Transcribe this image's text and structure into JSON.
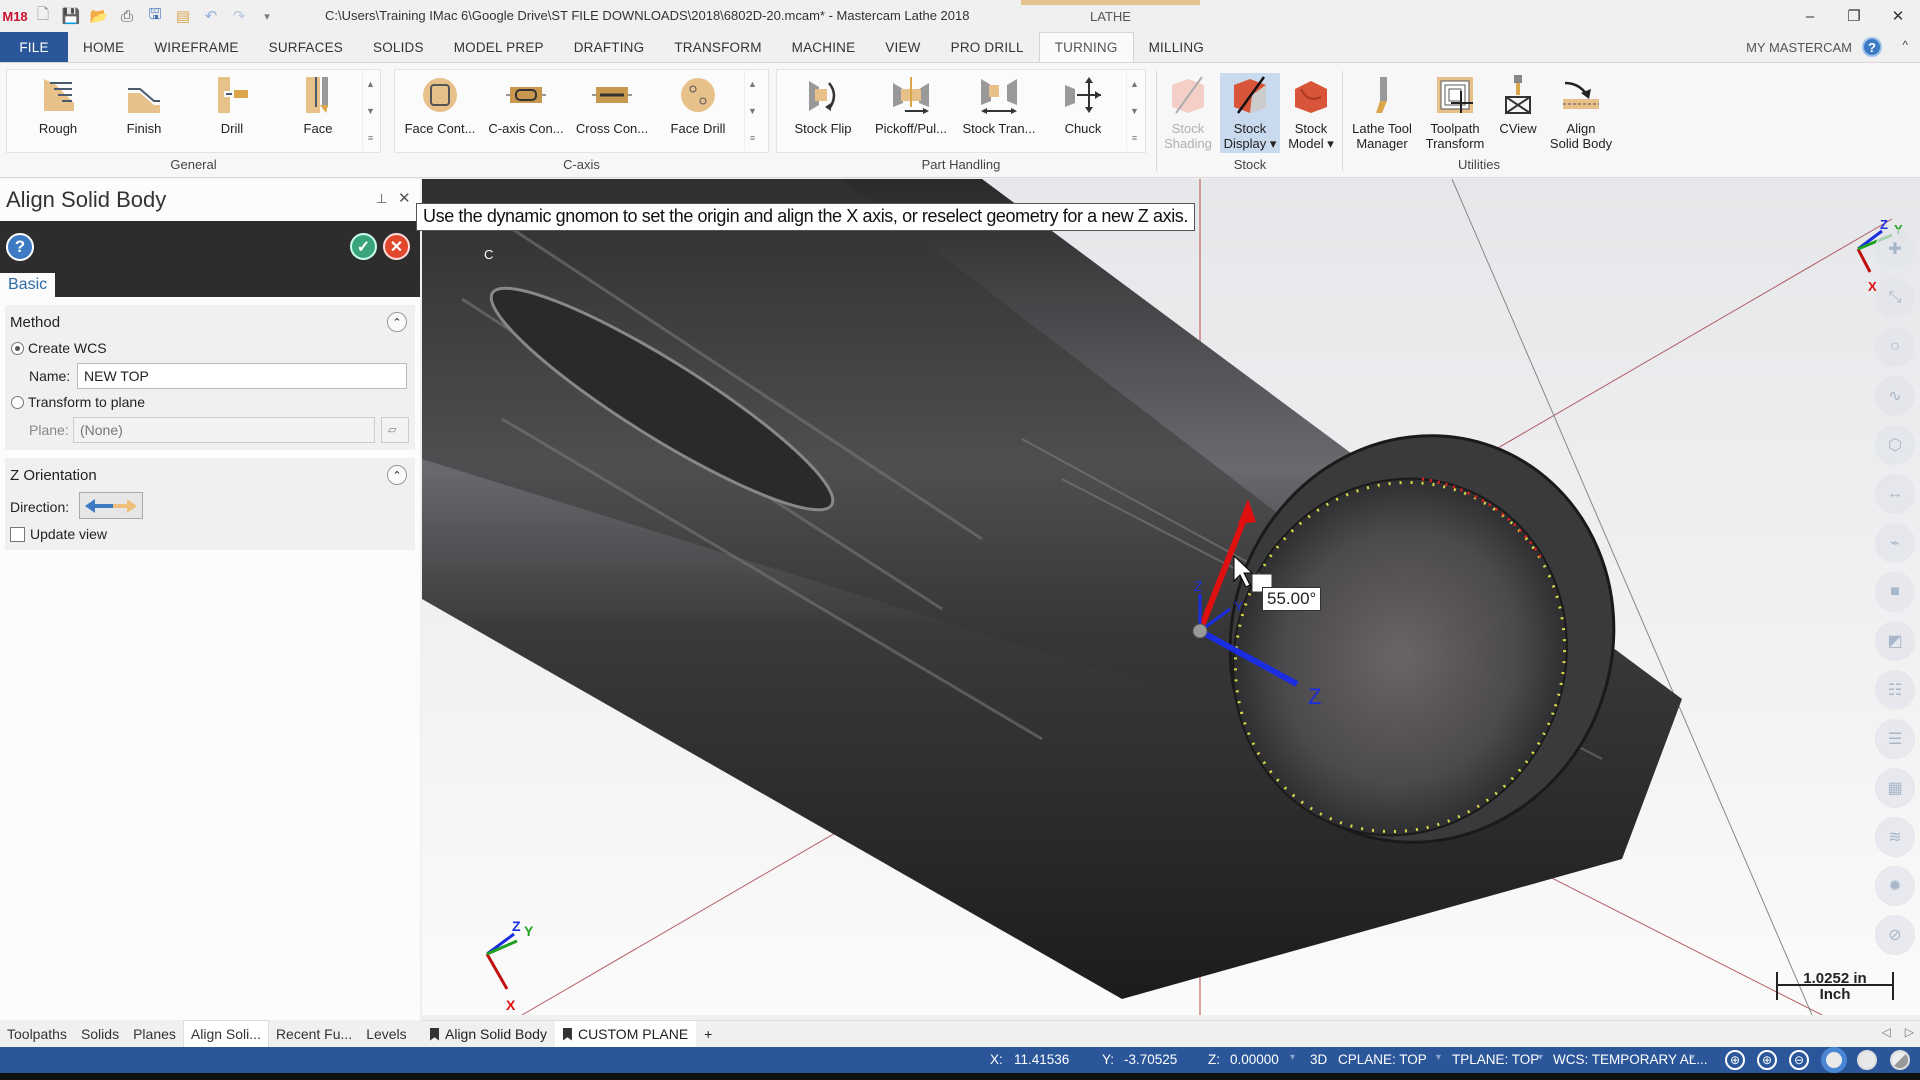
{
  "titlebar": {
    "title": "C:\\Users\\Training IMac 6\\Google Drive\\ST FILE DOWNLOADS\\2018\\6802D-20.mcam* - Mastercam Lathe 2018",
    "context_group": "LATHE",
    "logo": "M18",
    "minimize": "–",
    "restore": "❐",
    "close": "✕"
  },
  "ribbon_tabs": [
    {
      "label": "FILE"
    },
    {
      "label": "HOME"
    },
    {
      "label": "WIREFRAME"
    },
    {
      "label": "SURFACES"
    },
    {
      "label": "SOLIDS"
    },
    {
      "label": "MODEL PREP"
    },
    {
      "label": "DRAFTING"
    },
    {
      "label": "TRANSFORM"
    },
    {
      "label": "MACHINE"
    },
    {
      "label": "VIEW"
    },
    {
      "label": "PRO DRILL"
    },
    {
      "label": "TURNING"
    },
    {
      "label": "MILLING"
    }
  ],
  "account": {
    "label": "MY MASTERCAM",
    "help": "?",
    "collapse": "^"
  },
  "ribbon": {
    "general": {
      "label": "General",
      "buttons": [
        "Rough",
        "Finish",
        "Drill",
        "Face"
      ]
    },
    "caxis": {
      "label": "C-axis",
      "buttons": [
        "Face Cont...",
        "C-axis Con...",
        "Cross Con...",
        "Face Drill"
      ]
    },
    "part_handling": {
      "label": "Part Handling",
      "buttons": [
        "Stock Flip",
        "Pickoff/Pul...",
        "Stock Tran...",
        "Chuck"
      ]
    },
    "stock": {
      "label": "Stock",
      "buttons": [
        {
          "l1": "Stock",
          "l2": "Shading",
          "disabled": true
        },
        {
          "l1": "Stock",
          "l2": "Display ▾",
          "selected": true
        },
        {
          "l1": "Stock",
          "l2": "Model ▾"
        }
      ]
    },
    "utilities": {
      "label": "Utilities",
      "buttons": [
        {
          "l1": "Lathe Tool",
          "l2": "Manager"
        },
        {
          "l1": "Toolpath",
          "l2": "Transform"
        },
        {
          "l1": "CView",
          "l2": ""
        },
        {
          "l1": "Align",
          "l2": "Solid Body"
        }
      ]
    }
  },
  "panel": {
    "title": "Align Solid Body",
    "pin": "⊥",
    "close": "✕",
    "help": "?",
    "ok": "✓",
    "cancel": "✕",
    "tab": "Basic",
    "method": {
      "heading": "Method",
      "toggle": "⌃",
      "create_wcs": "Create WCS",
      "create_wcs_selected": true,
      "name_label": "Name:",
      "name_value": "NEW TOP",
      "transform_to_plane": "Transform to plane",
      "plane_label": "Plane:",
      "plane_value": "(None)"
    },
    "z_orientation": {
      "heading": "Z Orientation",
      "toggle": "⌃",
      "direction_label": "Direction:",
      "update_view": "Update view",
      "update_view_checked": false
    }
  },
  "viewport": {
    "prompt": "Use the dynamic gnomon to set the origin and align the X axis, or reselect geometry for a new Z axis.",
    "angle": "55.00°",
    "scale_value": "1.0252 in",
    "scale_unit": "Inch",
    "gnomon_labels": {
      "x": "X",
      "y": "Y",
      "z": "Z",
      "c": "C"
    },
    "side_toolbar": [
      "add-point",
      "line-endpoints",
      "circle",
      "spline",
      "solid-box",
      "dimension",
      "ruler",
      "solid",
      "plane",
      "levels-list",
      "tool-list",
      "color-grid",
      "layers",
      "settings",
      "clear"
    ]
  },
  "bottom_tabs": [
    {
      "label": "Toolpaths"
    },
    {
      "label": "Solids"
    },
    {
      "label": "Planes"
    },
    {
      "label": "Align Soli...",
      "active": true
    },
    {
      "label": "Recent Fu..."
    },
    {
      "label": "Levels"
    }
  ],
  "view_tabs": [
    {
      "label": "Align Solid Body"
    },
    {
      "label": "CUSTOM PLANE",
      "active": true
    },
    {
      "label": "+"
    }
  ],
  "statusbar": {
    "x_label": "X:",
    "x_value": "11.41536",
    "y_label": "Y:",
    "y_value": "-3.70525",
    "z_label": "Z:",
    "z_value": "0.00000",
    "mode": "3D",
    "cplane": "CPLANE: TOP",
    "tplane": "TPLANE: TOP",
    "wcs": "WCS: TEMPORARY AL..."
  },
  "colors": {
    "accent": "#2b579a",
    "context_tab": "#e7c38f",
    "ok": "#3aa57a",
    "cancel": "#e0472c"
  }
}
